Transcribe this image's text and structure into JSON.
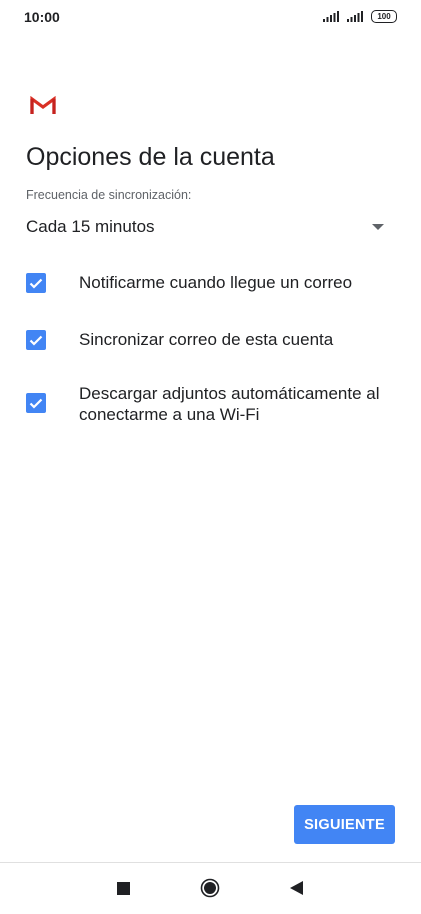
{
  "status_bar": {
    "time": "10:00",
    "battery": "100"
  },
  "colors": {
    "accent": "#4285f4",
    "text_primary": "#202124",
    "text_secondary": "#5f6368",
    "gmail_red": "#d93025"
  },
  "icons": {
    "logo": "gmail-logo-icon",
    "dropdown": "triangle-down-icon",
    "checkbox": "checkbox-checked-icon",
    "nav_recents": "square-icon",
    "nav_home": "circle-icon",
    "nav_back": "triangle-left-icon"
  },
  "page": {
    "title": "Opciones de la cuenta"
  },
  "sync": {
    "label": "Frecuencia de sincronización:",
    "selected": "Cada 15 minutos"
  },
  "options": [
    {
      "label": "Notificarme cuando llegue un correo",
      "checked": true
    },
    {
      "label": "Sincronizar correo de esta cuenta",
      "checked": true
    },
    {
      "label": "Descargar adjuntos automáticamente al conectarme a una Wi-Fi",
      "checked": true
    }
  ],
  "actions": {
    "next_label": "SIGUIENTE"
  }
}
